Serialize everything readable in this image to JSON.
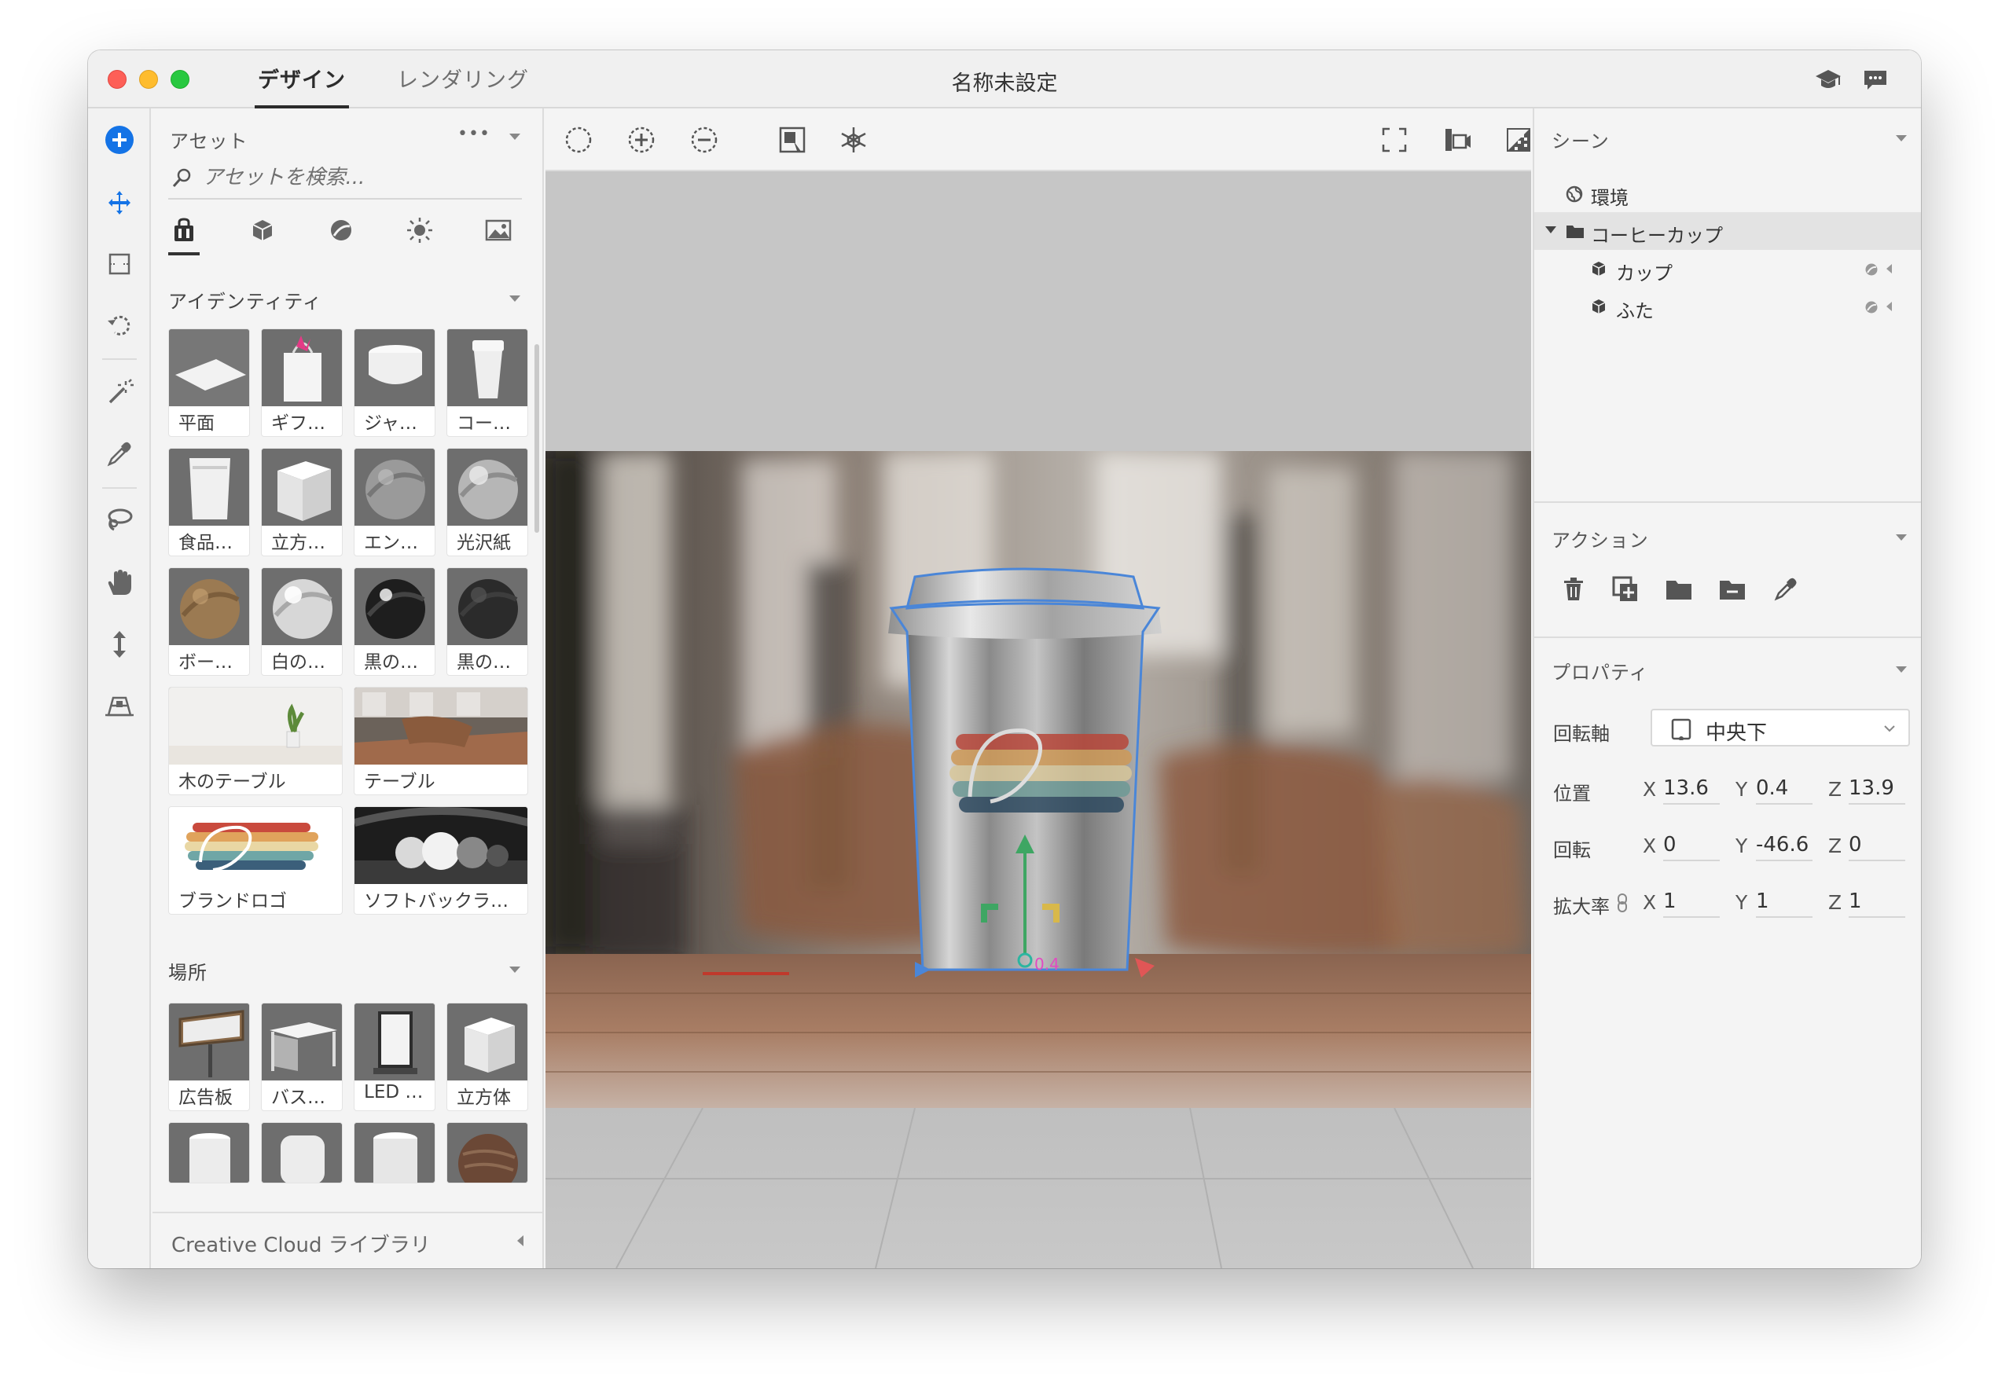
{
  "titlebar": {
    "tabs": [
      "デザイン",
      "レンダリング"
    ],
    "document_title": "名称未設定",
    "icons": [
      "graduation-cap-icon",
      "chat-bubble-icon"
    ]
  },
  "rail": {
    "tools": [
      "add-icon",
      "move-select-icon",
      "crop-frame-icon",
      "undo-rotate-icon",
      "magic-wand-icon",
      "eyedropper-icon",
      "lasso-icon",
      "hand-icon",
      "vertical-move-icon",
      "camera-perspective-icon"
    ],
    "accent": "#1473e6"
  },
  "assets": {
    "title": "アセット",
    "more_label": "•••",
    "search_placeholder": "アセットを検索...",
    "category_icons": [
      "bag-icon",
      "cube-icon",
      "material-icon",
      "light-icon",
      "image-icon"
    ],
    "section_identity": "アイデンティティ",
    "section_places": "場所",
    "identity_items": [
      "平面",
      "ギフ…",
      "ジャ…",
      "コー…",
      "食品…",
      "立方…",
      "エン…",
      "光沢紙",
      "ボー…",
      "白の…",
      "黒の…",
      "黒の…",
      "木のテーブル",
      "テーブル",
      "ブランドロゴ",
      "ソフトバックラ…"
    ],
    "place_items": [
      "広告板",
      "バス…",
      "LED …",
      "立方体"
    ],
    "footer": "Creative Cloud ライブラリ"
  },
  "viewport": {
    "tools_left": [
      "select-ellipse-icon",
      "add-selection-icon",
      "subtract-selection-icon",
      "frame-object-icon",
      "transform-gizmo-icon"
    ],
    "tools_right": [
      "fullscreen-icon",
      "camera-bookmark-icon",
      "render-preview-icon"
    ],
    "gizmo_value": "0.4"
  },
  "scene": {
    "title": "シーン",
    "items": [
      {
        "label": "環境",
        "icon": "globe-icon",
        "level": 0
      },
      {
        "label": "コーヒーカップ",
        "icon": "folder-icon",
        "level": 0,
        "expanded": true
      },
      {
        "label": "カップ",
        "icon": "cube-icon",
        "level": 1
      },
      {
        "label": "ふた",
        "icon": "cube-icon",
        "level": 1
      }
    ]
  },
  "actions": {
    "title": "アクション",
    "icons": [
      "trash-icon",
      "duplicate-icon",
      "group-folder-icon",
      "ungroup-folder-icon",
      "eyedropper-icon"
    ]
  },
  "properties": {
    "title": "プロパティ",
    "pivot_label": "回転軸",
    "pivot_value": "中央下",
    "position_label": "位置",
    "rotation_label": "回転",
    "scale_label": "拡大率",
    "axis_x": "X",
    "axis_y": "Y",
    "axis_z": "Z",
    "position": {
      "x": "13.6",
      "y": "0.4",
      "z": "13.9"
    },
    "rotation": {
      "x": "0",
      "y": "-46.6",
      "z": "0"
    },
    "scale": {
      "x": "1",
      "y": "1",
      "z": "1"
    }
  }
}
